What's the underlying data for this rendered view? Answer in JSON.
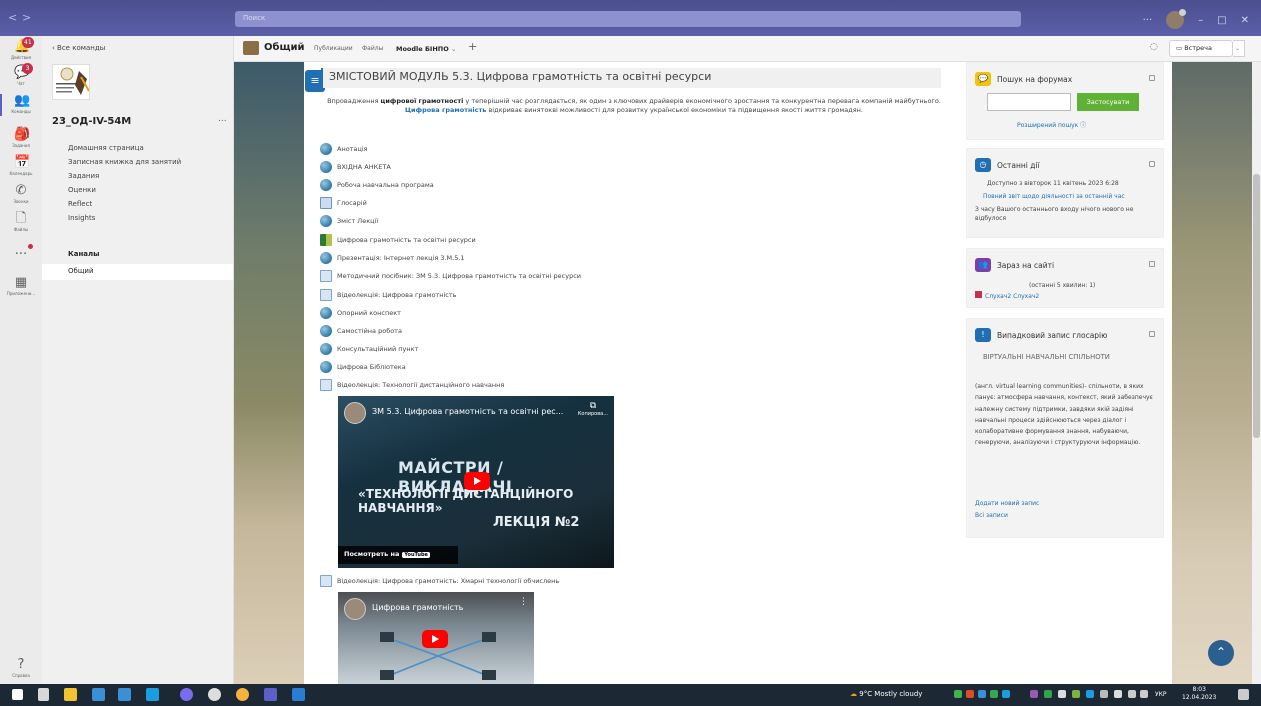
{
  "window": {
    "search_placeholder": "Поиск",
    "nav_back": "<",
    "nav_forward": ">",
    "controls": {
      "more": "···",
      "minimize": "–",
      "maximize": "□",
      "close": "✕"
    }
  },
  "rail": {
    "items": [
      {
        "label": "Действия",
        "badge": "41"
      },
      {
        "label": "Чат",
        "badge": "3"
      },
      {
        "label": "Команды",
        "badge": ""
      },
      {
        "label": "Задания",
        "badge": ""
      },
      {
        "label": "Календарь",
        "badge": ""
      },
      {
        "label": "Звонки",
        "badge": ""
      },
      {
        "label": "Файлы",
        "badge": ""
      },
      {
        "label": "...",
        "badge": ""
      },
      {
        "label": "Приложени...",
        "badge": ""
      },
      {
        "label": "Справка",
        "badge": ""
      }
    ]
  },
  "sidepanel": {
    "back_label": "Все команды",
    "logo_text": "2023 ЗАК ПРОЄКТНЕ УПРАВЛІННЯ",
    "team_name": "23_ОД-IV-54М",
    "more": "...",
    "links": [
      "Домашняя страница",
      "Записная книжка для занятий",
      "Задания",
      "Оценки",
      "Reflect",
      "Insights"
    ],
    "channels_header": "Каналы",
    "channel_general": "Общий"
  },
  "tabbar": {
    "title": "Общий",
    "tabs": [
      "Публикации",
      "Файлы"
    ],
    "active_tab": "Moodle БІНПО",
    "add": "+",
    "meet_label": "Встреча",
    "meet_dropdown": "⌄"
  },
  "moodle": {
    "drawer_icon": "≡",
    "module_title": "ЗМІСТОВИЙ МОДУЛЬ 5.3. Цифрова грамотність та освітні ресурси",
    "desc": {
      "p1": "Впровадження ",
      "b1": "цифрової грамотності",
      "p2": " у теперішній час розглядається, як один з ключових драйверів економічного зростання та конкурентна перевага компаній майбутнього. ",
      "l1": "Цифрова грамотність",
      "p3": " відкриває винятокві можливості для розвитку української економіки та підвищення якості життя громадян."
    },
    "activities": [
      {
        "label": "Анотація",
        "icon": "url"
      },
      {
        "label": "ВХІДНА АНКЕТА",
        "icon": "url"
      },
      {
        "label": "Робоча навчальна програма",
        "icon": "url"
      },
      {
        "label": "Глосарій",
        "icon": "glossary"
      },
      {
        "label": "Зміст Лекції",
        "icon": "url"
      },
      {
        "label": "Цифрова грамотність та освітні ресурси",
        "icon": "book"
      },
      {
        "label": "Презентація: Інтернет лекція 3.М.5.1",
        "icon": "url"
      },
      {
        "label": "Методичний посібник: ЗМ 5.3. Цифрова грамотність та освітні ресурси",
        "icon": "page"
      },
      {
        "label": "Відеолекція: Цифрова грамотність",
        "icon": "page"
      },
      {
        "label": "Опорний конспект",
        "icon": "url"
      },
      {
        "label": "Самостійна робота",
        "icon": "url"
      },
      {
        "label": "Консультаційний пункт",
        "icon": "url"
      },
      {
        "label": "Цифрова Бібліотека",
        "icon": "url"
      },
      {
        "label": "Відеолекція: Технології дистанційного навчання",
        "icon": "page"
      }
    ],
    "video1": {
      "title": "ЗМ 5.3. Цифрова грамотність та освітні рес...",
      "copy": "Копирова...",
      "line1": "МАЙСТРИ / ВИКЛАДАЧІ",
      "line2": "«ТЕХНОЛОГІЇ ДИСТАНЦІЙНОГО НАВЧАННЯ»",
      "line3": "ЛЕКЦІЯ №2",
      "watch": "Посмотреть на",
      "yt": "YouTube"
    },
    "activity_after_video": {
      "label": "Відеолекція: Цифрова грамотність: Хмарні технології обчислень",
      "icon": "page"
    },
    "video2": {
      "title": "Цифрова грамотність",
      "more": "⋮"
    }
  },
  "blocks": {
    "forum": {
      "title": "Пошук на форумах",
      "apply": "Застосувати",
      "advanced": "Розширений пошук ⓘ"
    },
    "recent": {
      "title": "Останні дії",
      "since": "Доступно з вівторок 11 квітень 2023 6:28",
      "report": "Повний звіт щодо діяльності за останній час",
      "none": "З часу Вашого останнього входу нічого нового не відбулося"
    },
    "online": {
      "title": "Зараз на сайті",
      "window": "(останні 5 хвилин: 1)",
      "user": "Слухач2 Слухач2"
    },
    "glossary": {
      "title": "Випадковий запис глосарію",
      "term": "ВІРТУАЛЬНІ НАВЧАЛЬНІ СПІЛЬНОТИ",
      "definition": "(англ. virtual learning communities)- спільноти, в яких панує: атмосфера навчання, контекст, який забезпечує належну систему підтримки, завдяки якій задіяні навчальні процеси здійснюються через діалог і колаборативне формування знання, набуваючи, генеруючи, аналізуючи і структуруючи інформацію.",
      "add": "Додати новий запис",
      "all": "Всі записи"
    }
  },
  "taskbar": {
    "weather": "9°C  Mostly cloudy",
    "lang": "УКР",
    "time": "8:03",
    "date": "12.04.2023"
  },
  "colors": {
    "teams_header": "#5b5fa9",
    "moodle_blue": "#1f6fb2",
    "apply_green": "#5fb235",
    "taskbar": "#1c2833"
  }
}
